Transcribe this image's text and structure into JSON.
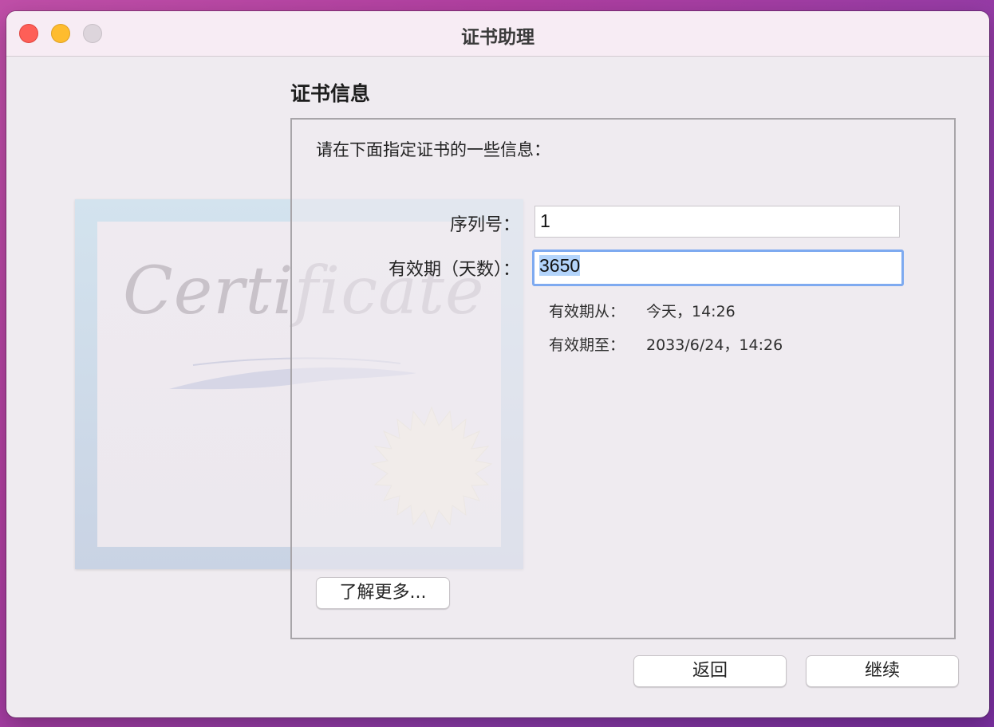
{
  "window": {
    "title": "证书助理"
  },
  "illustration": {
    "certificate_text": "Certificate"
  },
  "section": {
    "title": "证书信息",
    "intro": "请在下面指定证书的一些信息："
  },
  "form": {
    "serial_label": "序列号：",
    "serial_value": "1",
    "validity_label": "有效期（天数）：",
    "validity_value": "3650",
    "valid_from_label": "有效期从：",
    "valid_from_value": "今天，14:26",
    "valid_to_label": "有效期至：",
    "valid_to_value": "2033/6/24，14:26"
  },
  "buttons": {
    "learn_more": "了解更多...",
    "back": "返回",
    "continue": "继续"
  },
  "colors": {
    "accent_focus": "#7eaaf0",
    "selection": "#b3d4fb",
    "close": "#fe5f57",
    "minimize": "#febc2e"
  }
}
